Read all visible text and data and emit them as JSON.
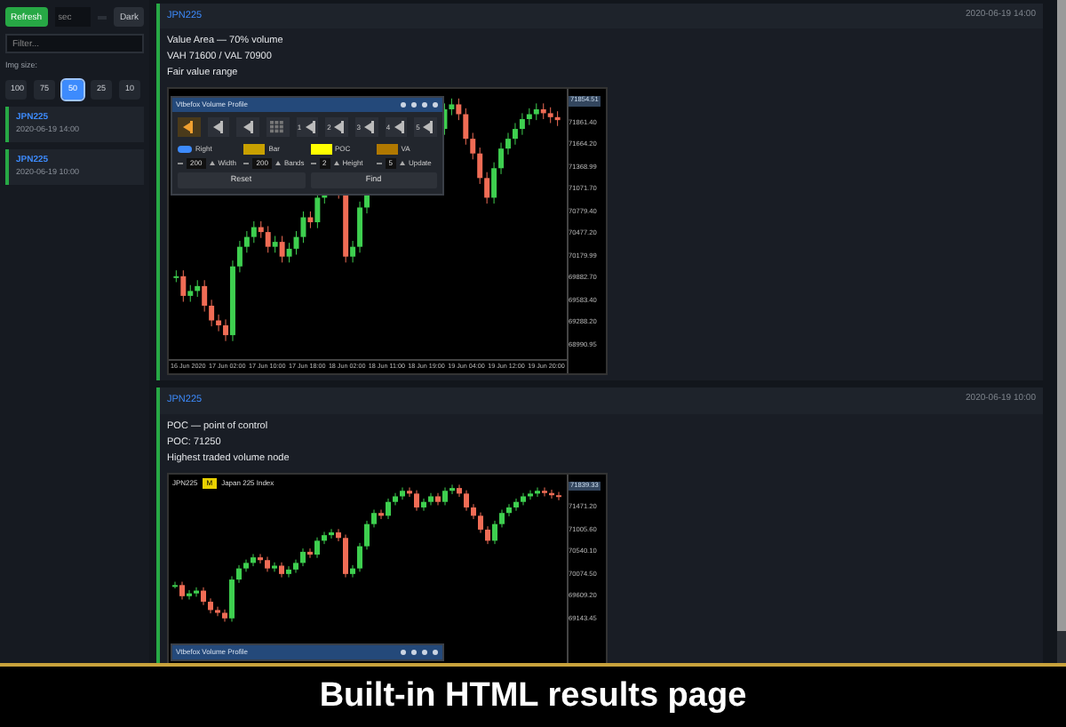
{
  "sidebar": {
    "refresh_button": "Refresh",
    "interval_field": {
      "placeholder": "sec"
    },
    "theme_button": "Dark",
    "filter_field": {
      "placeholder": "Filter..."
    },
    "img_size_label": "Img size:",
    "img_sizes": [
      {
        "label": "100",
        "selected": false
      },
      {
        "label": "75",
        "selected": false
      },
      {
        "label": "50",
        "selected": true
      },
      {
        "label": "25",
        "selected": false
      },
      {
        "label": "10",
        "selected": false
      }
    ],
    "results": [
      {
        "symbol": "JPN225",
        "time": "2020-06-19 14:00"
      },
      {
        "symbol": "JPN225",
        "time": "2020-06-19 10:00"
      }
    ]
  },
  "results": [
    {
      "symbol": "JPN225",
      "time": "2020-06-19 14:00",
      "lines": [
        "Value Area — 70% volume",
        "VAH 71600 / VAL 70900",
        "Fair value range"
      ],
      "chart": {
        "price_tag": "71854.51",
        "y_labels": [
          "71861.40",
          "71664.20",
          "71368.99",
          "71071.70",
          "70779.40",
          "70477.20",
          "70179.99",
          "69882.70",
          "69583.40",
          "69288.20",
          "68990.95"
        ],
        "x_labels": [
          "16 Jun 2020",
          "17 Jun 02:00",
          "17 Jun 10:00",
          "17 Jun 18:00",
          "18 Jun 02:00",
          "18 Jun 11:00",
          "18 Jun 19:00",
          "19 Jun 04:00",
          "19 Jun 12:00",
          "19 Jun 20:00"
        ],
        "panel": {
          "title": "Vtbefox Volume Profile",
          "tools": [
            {
              "kind": "bar",
              "selected": true
            },
            {
              "kind": "bar",
              "selected": false
            },
            {
              "kind": "bar",
              "selected": false
            },
            {
              "kind": "grid",
              "selected": false
            },
            {
              "kind": "numbered",
              "label": "1",
              "selected": false
            },
            {
              "kind": "numbered",
              "label": "2",
              "selected": false
            },
            {
              "kind": "numbered",
              "label": "3",
              "selected": false
            },
            {
              "kind": "numbered",
              "label": "4",
              "selected": false
            },
            {
              "kind": "numbered",
              "label": "5",
              "selected": false
            }
          ],
          "toggle": {
            "label": "Right",
            "on": true
          },
          "swatches": [
            {
              "label": "Bar",
              "color": "#c8a000"
            },
            {
              "label": "POC",
              "color": "#ffff00"
            },
            {
              "label": "VA",
              "color": "#b07800"
            }
          ],
          "steppers": [
            {
              "value": "200",
              "label": "Width"
            },
            {
              "value": "200",
              "label": "Bands"
            },
            {
              "value": "2",
              "label": "Height"
            },
            {
              "value": "5",
              "label": "Update"
            }
          ],
          "buttons": [
            "Reset",
            "Find"
          ]
        }
      }
    },
    {
      "symbol": "JPN225",
      "time": "2020-06-19 10:00",
      "lines": [
        "POC — point of control",
        "POC: 71250",
        "Highest traded volume node"
      ],
      "chart": {
        "legend": {
          "symbol": "JPN225",
          "badge": "M",
          "name": "Japan 225 Index"
        },
        "price_tag": "71839.33",
        "y_labels": [
          "71471.20",
          "71005.60",
          "70540.10",
          "70074.50",
          "69609.20",
          "69143.45"
        ],
        "panel": {
          "title": "Vtbefox Volume Profile"
        }
      }
    }
  ],
  "caption": "Built-in HTML results page"
}
